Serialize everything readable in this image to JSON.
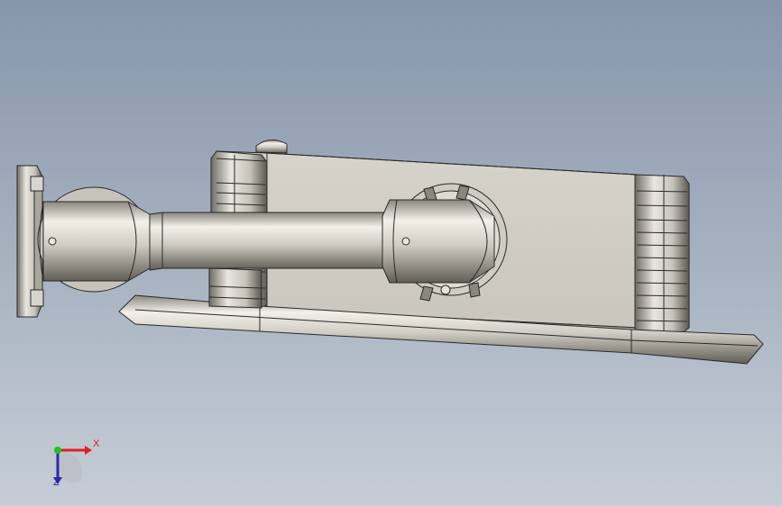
{
  "viewport": {
    "background_top": "#8796ab",
    "background_bottom": "#c6cdd6"
  },
  "model": {
    "body_color": "#d8d6cc",
    "edge_color": "#2a2a2a",
    "highlight_color": "#f4f2ea",
    "shadow_color": "#5e5c52"
  },
  "triad": {
    "x_label": "X",
    "z_label": "Z",
    "x_color": "#e02020",
    "y_color": "#22c022",
    "z_color": "#2a2aa8"
  }
}
